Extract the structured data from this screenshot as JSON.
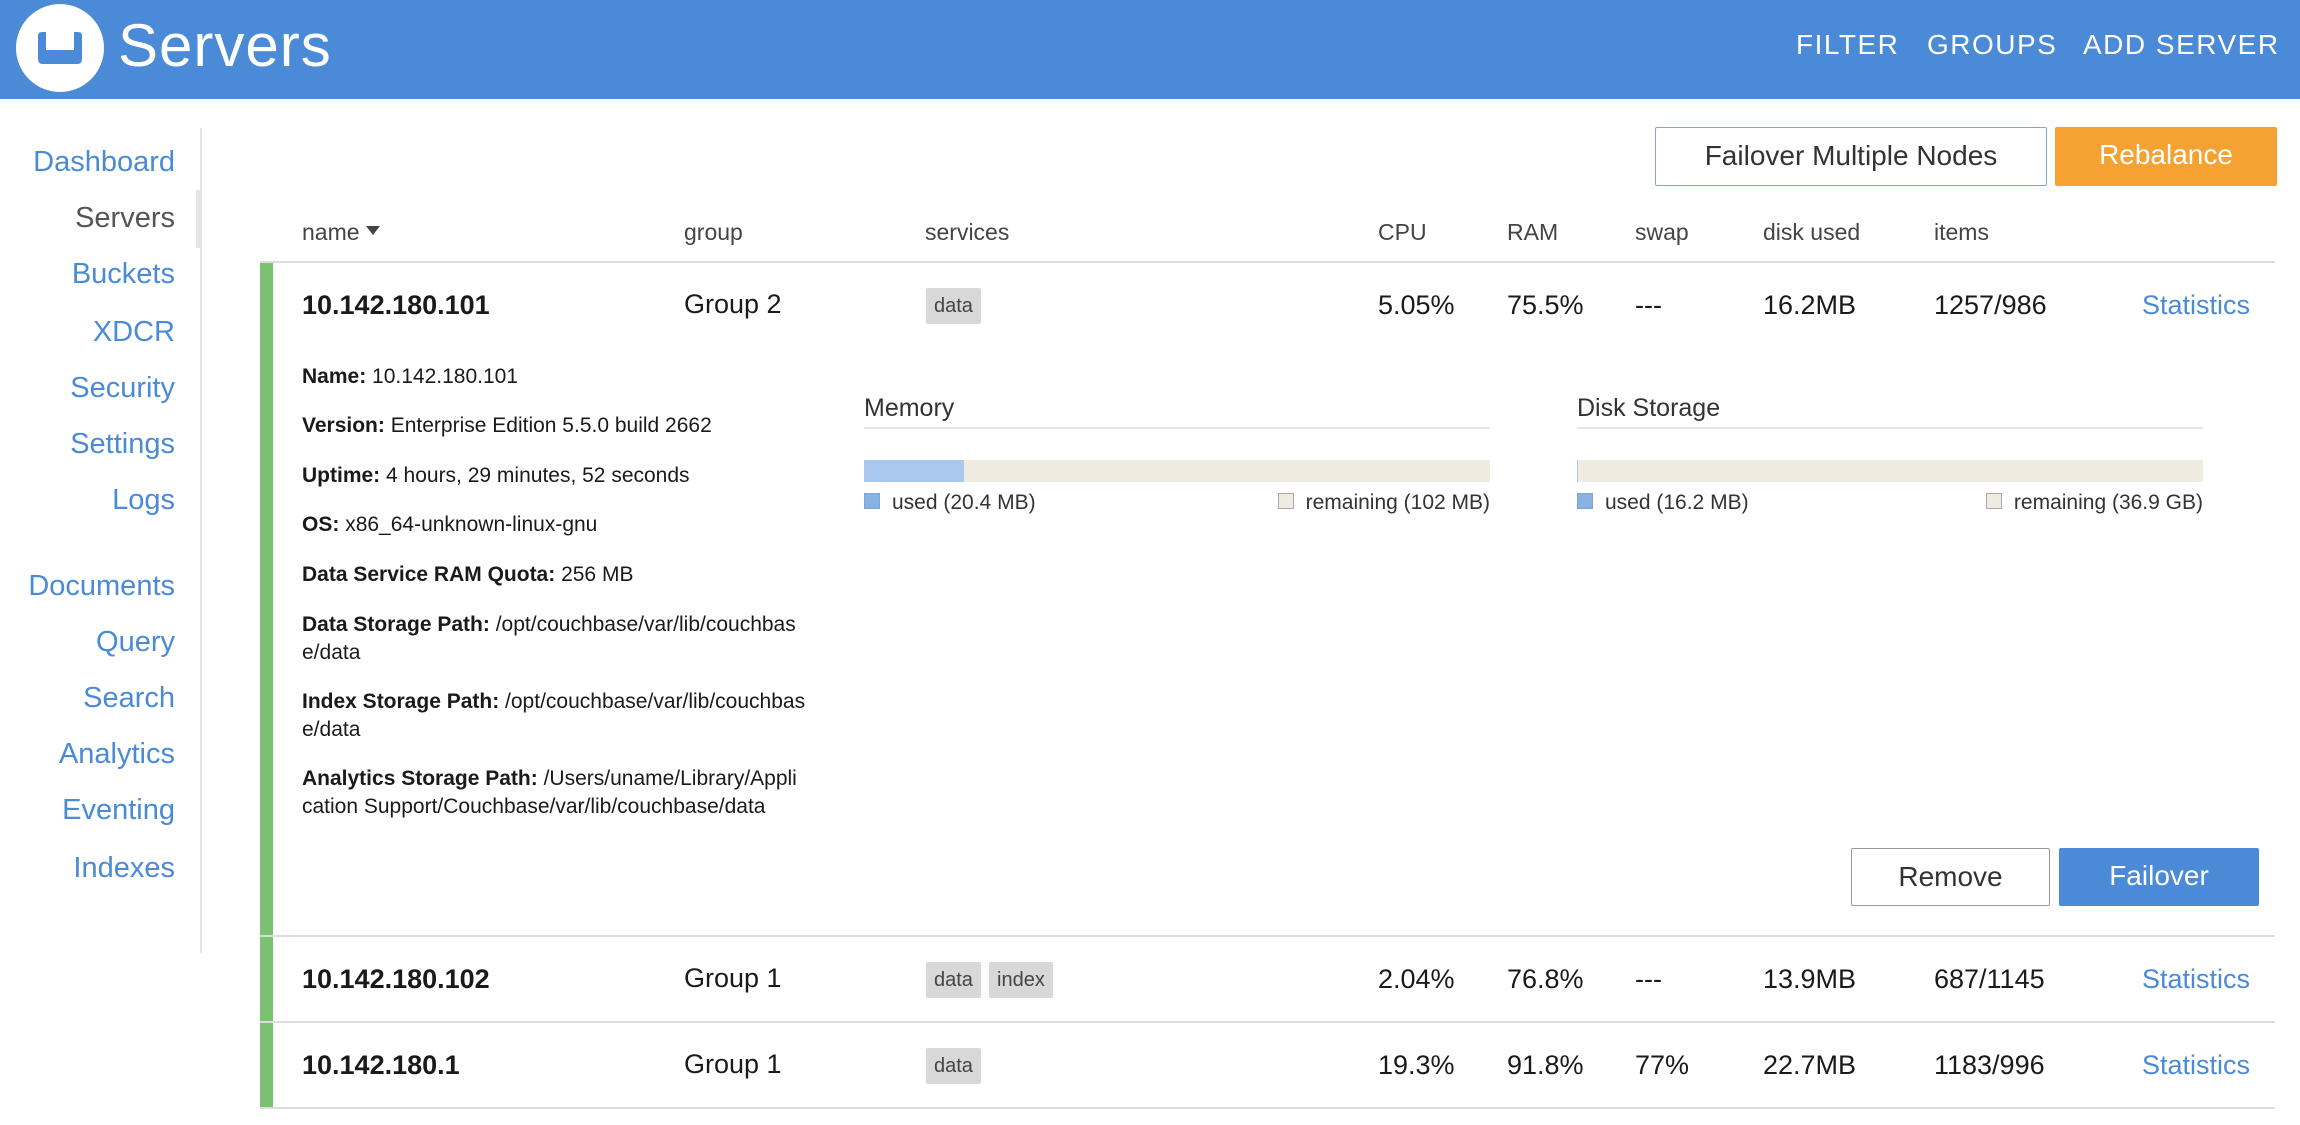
{
  "header": {
    "title": "Servers",
    "nav": {
      "filter": "FILTER",
      "groups": "GROUPS",
      "add_server": "ADD SERVER"
    }
  },
  "sidebar": {
    "items": [
      {
        "label": "Dashboard"
      },
      {
        "label": "Servers",
        "active": true
      },
      {
        "label": "Buckets"
      },
      {
        "label": "XDCR"
      },
      {
        "label": "Security"
      },
      {
        "label": "Settings"
      },
      {
        "label": "Logs"
      },
      {
        "label": "Documents"
      },
      {
        "label": "Query"
      },
      {
        "label": "Search"
      },
      {
        "label": "Analytics"
      },
      {
        "label": "Eventing"
      },
      {
        "label": "Indexes"
      }
    ]
  },
  "toolbar": {
    "failover_multiple": "Failover Multiple Nodes",
    "rebalance": "Rebalance"
  },
  "columns": {
    "name": "name",
    "group": "group",
    "services": "services",
    "cpu": "CPU",
    "ram": "RAM",
    "swap": "swap",
    "disk_used": "disk used",
    "items": "items"
  },
  "servers": [
    {
      "name": "10.142.180.101",
      "group": "Group 2",
      "services": [
        "data"
      ],
      "cpu": "5.05%",
      "ram": "75.5%",
      "swap": "---",
      "disk_used": "16.2MB",
      "items": "1257/986",
      "link": "Statistics",
      "status": "healthy",
      "expanded": true
    },
    {
      "name": "10.142.180.102",
      "group": "Group 1",
      "services": [
        "data",
        "index"
      ],
      "cpu": "2.04%",
      "ram": "76.8%",
      "swap": "---",
      "disk_used": "13.9MB",
      "items": "687/1145",
      "link": "Statistics",
      "status": "healthy"
    },
    {
      "name": "10.142.180.1",
      "group": "Group 1",
      "services": [
        "data"
      ],
      "cpu": "19.3%",
      "ram": "91.8%",
      "swap": "77%",
      "disk_used": "22.7MB",
      "items": "1183/996",
      "link": "Statistics",
      "status": "healthy"
    }
  ],
  "details": {
    "fields": [
      {
        "label": "Name:",
        "value": "10.142.180.101"
      },
      {
        "label": "Version:",
        "value": "Enterprise Edition 5.5.0 build 2662"
      },
      {
        "label": "Uptime:",
        "value": "4 hours, 29 minutes, 52 seconds"
      },
      {
        "label": "OS:",
        "value": "x86_64-unknown-linux-gnu"
      },
      {
        "label": "Data Service RAM Quota:",
        "value": "256 MB"
      },
      {
        "label": "Data Storage Path:",
        "value": "/opt/couchbase/var/lib/couchbase/data"
      },
      {
        "label": "Index Storage Path:",
        "value": "/opt/couchbase/var/lib/couchbase/data"
      },
      {
        "label": "Analytics Storage Path:",
        "value": "/Users/uname/Library/Application Support/Couchbase/var/lib/couchbase/data"
      }
    ],
    "memory": {
      "title": "Memory",
      "used": "used (20.4 MB)",
      "remaining": "remaining (102 MB)",
      "used_fraction": 0.16
    },
    "disk": {
      "title": "Disk Storage",
      "used": "used (16.2 MB)",
      "remaining": "remaining (36.9 GB)",
      "used_fraction": 0.0004
    },
    "remove": "Remove",
    "failover": "Failover"
  },
  "colors": {
    "header": "#4a8ad6",
    "accent": "#f5a233",
    "link": "#4a8ad6",
    "healthy": "#7ac271",
    "used": "#aac8ef",
    "track": "#efebe1"
  }
}
